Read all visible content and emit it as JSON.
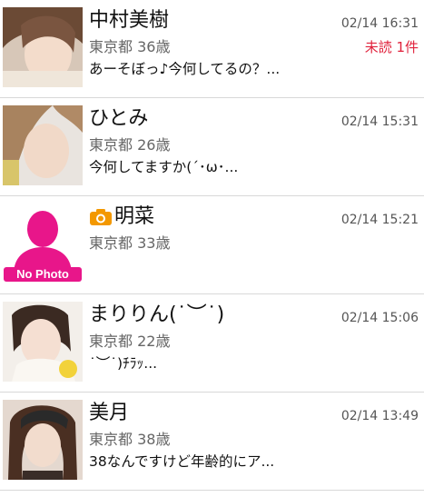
{
  "messages": [
    {
      "name": "中村美樹",
      "has_camera": false,
      "location": "東京都",
      "age": "36歳",
      "time": "02/14 16:31",
      "unread": "未読 1件",
      "preview": "あーそぼっ♪今何してるの？..."
    },
    {
      "name": "ひとみ",
      "has_camera": false,
      "location": "東京都",
      "age": "26歳",
      "time": "02/14 15:31",
      "unread": "",
      "preview": "今何してますか(´･ω･..."
    },
    {
      "name": "明菜",
      "has_camera": true,
      "location": "東京都",
      "age": "33歳",
      "time": "02/14 15:21",
      "unread": "",
      "preview": "",
      "no_photo_label": "No Photo"
    },
    {
      "name": "まりりん(˙︶˙)",
      "has_camera": false,
      "location": "東京都",
      "age": "22歳",
      "time": "02/14 15:06",
      "unread": "",
      "preview": "˙︶˙)ﾁﾗｯ..."
    },
    {
      "name": "美月",
      "has_camera": false,
      "location": "東京都",
      "age": "38歳",
      "time": "02/14 13:49",
      "unread": "",
      "preview": "38なんですけど年齢的にア..."
    }
  ],
  "colors": {
    "unread": "#e0223c",
    "no_photo_pink": "#e8168a",
    "camera_orange": "#f39800"
  }
}
